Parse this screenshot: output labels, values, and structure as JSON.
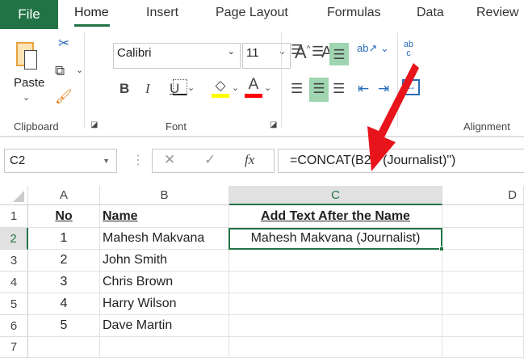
{
  "tabs": {
    "file": "File",
    "home": "Home",
    "insert": "Insert",
    "page_layout": "Page Layout",
    "formulas": "Formulas",
    "data": "Data",
    "review": "Review"
  },
  "ribbon": {
    "paste": "Paste",
    "font_name": "Calibri",
    "font_size": "11",
    "clipboard": "Clipboard",
    "font": "Font",
    "alignment": "Alignment",
    "bold": "B",
    "italic": "I",
    "underline": "U",
    "font_color": "A",
    "grow": "A",
    "shrink": "A",
    "wrap": "ab c"
  },
  "formula_bar": {
    "name_box": "C2",
    "formula": "=CONCAT(B2,\" (Journalist)\")",
    "fx": "fx",
    "cancel": "✕",
    "enter": "✓"
  },
  "columns": [
    "A",
    "B",
    "C",
    "D"
  ],
  "rows": [
    "1",
    "2",
    "3",
    "4",
    "5",
    "6",
    "7"
  ],
  "cells": [
    [
      "No",
      "Name",
      "Add Text After the Name"
    ],
    [
      "1",
      "Mahesh Makvana",
      "Mahesh Makvana (Journalist)"
    ],
    [
      "2",
      "John Smith",
      ""
    ],
    [
      "3",
      "Chris Brown",
      ""
    ],
    [
      "4",
      "Harry Wilson",
      ""
    ],
    [
      "5",
      "Dave Martin",
      ""
    ],
    [
      "",
      "",
      ""
    ]
  ],
  "colors": {
    "accent": "#217346",
    "arrow": "#e8141b",
    "highlight": "#ffff00",
    "font_red": "#ff0000"
  }
}
